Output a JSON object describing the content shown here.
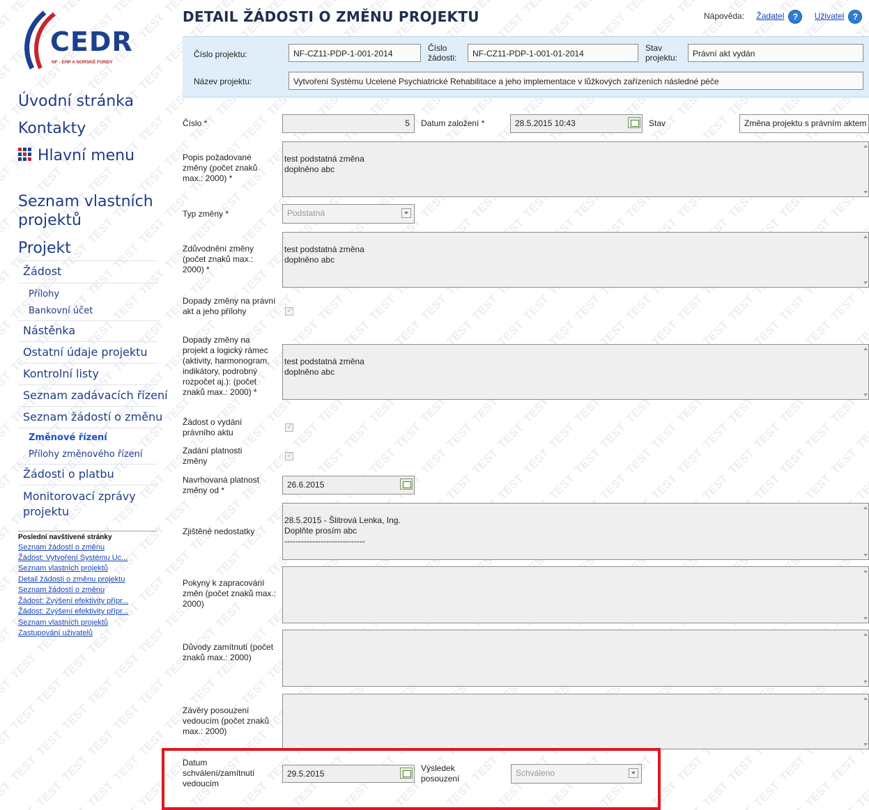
{
  "logo": {
    "text": "CEDR",
    "subtitle": "NF - EHP A NORSKÉ FONDY"
  },
  "sidebar": {
    "home": "Úvodní stránka",
    "contacts": "Kontakty",
    "main_menu": "Hlavní menu",
    "own_projects": "Seznam vlastních projektů",
    "project": "Projekt",
    "request": "Žádost",
    "attachments": "Přílohy",
    "bank_account": "Bankovní účet",
    "dashboard": "Nástěnka",
    "other_data": "Ostatní údaje projektu",
    "checklists": "Kontrolní listy",
    "procurements": "Seznam zadávacích řízení",
    "change_requests": "Seznam žádostí o změnu",
    "change_procedure": "Změnové řízení",
    "change_attachments": "Přílohy změnového řízení",
    "payment_requests": "Žádosti o platbu",
    "monitoring_reports": "Monitorovací zprávy projektu"
  },
  "recent": {
    "title": "Poslední navštívené stránky",
    "links": [
      "Seznam žádostí o změnu",
      "Žádost: Vytvoření Systému Uc...",
      "Seznam vlastních projektů",
      "Detail žádosti o změnu projektu",
      "Seznam žádostí o změnu",
      "Žádost: Zvýšení efektivity přípr...",
      "Žádost: Zvýšení efektivity přípr...",
      "Seznam vlastních projektů",
      "Zastupování uživatelů"
    ]
  },
  "header": {
    "title": "DETAIL ŽÁDOSTI O ZMĚNU PROJEKTU",
    "help_label": "Nápověda:",
    "help_applicant": "Žadatel",
    "help_user": "Uživatel"
  },
  "info": {
    "project_number_label": "Číslo projektu:",
    "project_number": "NF-CZ11-PDP-1-001-2014",
    "request_number_label": "Číslo žádosti:",
    "request_number": "NF-CZ11-PDP-1-001-01-2014",
    "project_state_label": "Stav projektu:",
    "project_state": "Právní akt vydán",
    "project_name_label": "Název projektu:",
    "project_name": "Vytvoření Systému Ucelené Psychiatrické Rehabilitace a jeho implementace v lůžkových zařízeních následné péče"
  },
  "form": {
    "number_label": "Číslo *",
    "number_value": "5",
    "created_label": "Datum založení *",
    "created_value": "28.5.2015 10:43",
    "state_label": "Stav",
    "state_value": "Změna projektu s právním aktem",
    "description_label": "Popis požadované změny (počet znaků max.: 2000) *",
    "description_value": "test podstatná změna\ndoplněno abc",
    "type_label": "Typ změny *",
    "type_value": "Podstatná",
    "justification_label": "Zdůvodnění změny (počet znaků max.: 2000) *",
    "justification_value": "test podstatná změna\ndoplněno abc",
    "impact_legal_label": "Dopady změny na právní akt a jeho přílohy",
    "impact_project_label": "Dopady změny na projekt a logický rámec (aktivity, harmonogram, indikátory, podrobný rozpočet aj.): (počet znaků max.: 2000) *",
    "impact_project_value": "test podstatná změna\ndoplněno abc",
    "legal_act_request_label": "Žádost o vydání právního aktu",
    "validity_entry_label": "Zadání platnosti změny",
    "proposed_validity_label": "Navrhovaná platnost změny od *",
    "proposed_validity_value": "26.6.2015",
    "deficiencies_label": "Zjištěné nedostatky",
    "deficiencies_value": "28.5.2015 - Šlitrová Lenka, Ing.\nDoplňte prosím abc\n-----------------------------",
    "instructions_label": "Pokyny k zapracování změn (počet znaků max.: 2000)",
    "rejection_label": "Důvody zamítnutí (počet znaků max.: 2000)",
    "conclusions_label": "Závěry posouzení vedoucím (počet znaků max.: 2000)",
    "approval_date_label": "Datum schválení/zamítnutí vedoucím",
    "approval_date_value": "29.5.2015",
    "result_label": "Výsledek posouzení",
    "result_value": "Schváleno"
  },
  "colors": {
    "highlight": "#e0161f",
    "nav": "#1e3c86",
    "info_bg": "#dfeef8"
  }
}
